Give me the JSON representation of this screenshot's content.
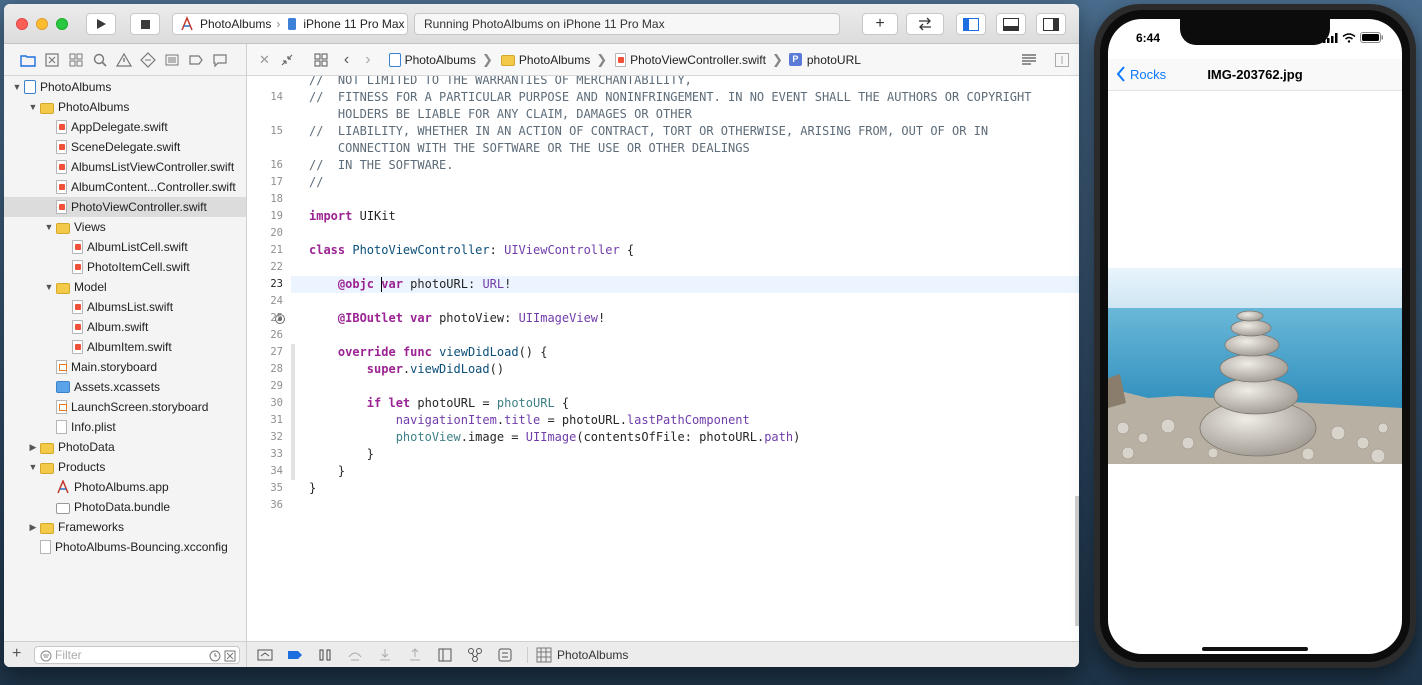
{
  "toolbar": {
    "scheme_target": "PhotoAlbums",
    "scheme_device": "iPhone 11 Pro Max",
    "activity_text": "Running PhotoAlbums on iPhone 11 Pro Max"
  },
  "navigator": {
    "items": [
      {
        "label": "PhotoAlbums",
        "icon": "project-icon",
        "indent": 0,
        "disclosure": "open"
      },
      {
        "label": "PhotoAlbums",
        "icon": "folder-icon",
        "indent": 1,
        "disclosure": "open"
      },
      {
        "label": "AppDelegate.swift",
        "icon": "swift-file-icon",
        "indent": 2
      },
      {
        "label": "SceneDelegate.swift",
        "icon": "swift-file-icon",
        "indent": 2
      },
      {
        "label": "AlbumsListViewController.swift",
        "icon": "swift-file-icon",
        "indent": 2
      },
      {
        "label": "AlbumContent...Controller.swift",
        "icon": "swift-file-icon",
        "indent": 2
      },
      {
        "label": "PhotoViewController.swift",
        "icon": "swift-file-icon",
        "indent": 2,
        "selected": true
      },
      {
        "label": "Views",
        "icon": "folder-icon",
        "indent": 2,
        "disclosure": "open"
      },
      {
        "label": "AlbumListCell.swift",
        "icon": "swift-file-icon",
        "indent": 3
      },
      {
        "label": "PhotoItemCell.swift",
        "icon": "swift-file-icon",
        "indent": 3
      },
      {
        "label": "Model",
        "icon": "folder-icon",
        "indent": 2,
        "disclosure": "open"
      },
      {
        "label": "AlbumsList.swift",
        "icon": "swift-file-icon",
        "indent": 3
      },
      {
        "label": "Album.swift",
        "icon": "swift-file-icon",
        "indent": 3
      },
      {
        "label": "AlbumItem.swift",
        "icon": "swift-file-icon",
        "indent": 3
      },
      {
        "label": "Main.storyboard",
        "icon": "storyboard-icon",
        "indent": 2
      },
      {
        "label": "Assets.xcassets",
        "icon": "assets-icon",
        "indent": 2
      },
      {
        "label": "LaunchScreen.storyboard",
        "icon": "storyboard-icon",
        "indent": 2
      },
      {
        "label": "Info.plist",
        "icon": "plist-icon",
        "indent": 2
      },
      {
        "label": "PhotoData",
        "icon": "folder-icon",
        "indent": 1,
        "disclosure": "closed"
      },
      {
        "label": "Products",
        "icon": "folder-icon",
        "indent": 1,
        "disclosure": "open"
      },
      {
        "label": "PhotoAlbums.app",
        "icon": "app-icon",
        "indent": 2
      },
      {
        "label": "PhotoData.bundle",
        "icon": "bundle-icon",
        "indent": 2
      },
      {
        "label": "Frameworks",
        "icon": "folder-icon",
        "indent": 1,
        "disclosure": "closed"
      },
      {
        "label": "PhotoAlbums-Bouncing.xcconfig",
        "icon": "xcconfig-icon",
        "indent": 1
      }
    ],
    "filter_placeholder": "Filter"
  },
  "jumpbar": {
    "crumbs": [
      "PhotoAlbums",
      "PhotoAlbums",
      "PhotoViewController.swift",
      "photoURL"
    ]
  },
  "editor": {
    "current_line": "23",
    "breakpoint_line": "25",
    "lines": [
      {
        "no": "",
        "code": "//  NOT LIMITED TO THE WARRANTIES OF MERCHANTABILITY,"
      },
      {
        "no": "14",
        "code": "//  FITNESS FOR A PARTICULAR PURPOSE AND NONINFRINGEMENT. IN NO EVENT SHALL THE AUTHORS OR COPYRIGHT"
      },
      {
        "no": "",
        "code": "    HOLDERS BE LIABLE FOR ANY CLAIM, DAMAGES OR OTHER"
      },
      {
        "no": "15",
        "code": "//  LIABILITY, WHETHER IN AN ACTION OF CONTRACT, TORT OR OTHERWISE, ARISING FROM, OUT OF OR IN"
      },
      {
        "no": "",
        "code": "    CONNECTION WITH THE SOFTWARE OR THE USE OR OTHER DEALINGS"
      },
      {
        "no": "16",
        "code": "//  IN THE SOFTWARE."
      },
      {
        "no": "17",
        "code": "//"
      },
      {
        "no": "18",
        "code": ""
      },
      {
        "no": "19",
        "code": "import UIKit"
      },
      {
        "no": "20",
        "code": ""
      },
      {
        "no": "21",
        "code": "class PhotoViewController: UIViewController {"
      },
      {
        "no": "22",
        "code": ""
      },
      {
        "no": "23",
        "code": "    @objc var photoURL: URL!"
      },
      {
        "no": "24",
        "code": ""
      },
      {
        "no": "25",
        "code": "    @IBOutlet var photoView: UIImageView!"
      },
      {
        "no": "26",
        "code": ""
      },
      {
        "no": "27",
        "code": "    override func viewDidLoad() {"
      },
      {
        "no": "28",
        "code": "        super.viewDidLoad()"
      },
      {
        "no": "29",
        "code": ""
      },
      {
        "no": "30",
        "code": "        if let photoURL = photoURL {"
      },
      {
        "no": "31",
        "code": "            navigationItem.title = photoURL.lastPathComponent"
      },
      {
        "no": "32",
        "code": "            photoView.image = UIImage(contentsOfFile: photoURL.path)"
      },
      {
        "no": "33",
        "code": "        }"
      },
      {
        "no": "34",
        "code": "    }"
      },
      {
        "no": "35",
        "code": "}"
      },
      {
        "no": "36",
        "code": ""
      }
    ]
  },
  "debugbar": {
    "target": "PhotoAlbums"
  },
  "simulator": {
    "time": "6:44",
    "back_label": "Rocks",
    "title": "IMG-203762.jpg"
  },
  "colors": {
    "accent_blue": "#0a7aff",
    "keyword": "#9b2393",
    "comment": "#5d6c79",
    "type": "#703daa",
    "folder": "#f3c94a"
  }
}
